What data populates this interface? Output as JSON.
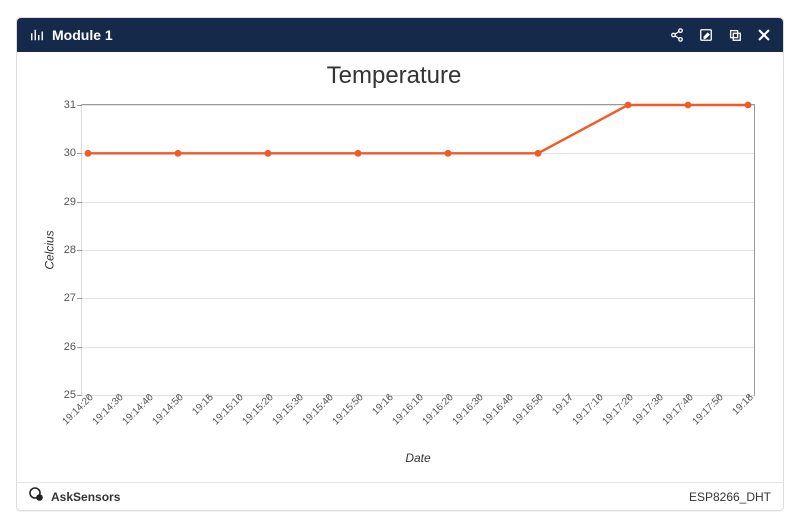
{
  "header": {
    "title": "Module 1",
    "iconName": "bar-chart-icon",
    "actions": {
      "share": "share-icon",
      "edit": "edit-icon",
      "copy": "copy-icon",
      "close": "close-icon"
    }
  },
  "footer": {
    "brand": "AskSensors",
    "device": "ESP8266_DHT"
  },
  "chart_data": {
    "type": "line",
    "title": "Temperature",
    "xlabel": "Date",
    "ylabel": "Celcius",
    "ylim": [
      25,
      31
    ],
    "yticks": [
      25,
      26,
      27,
      28,
      29,
      30,
      31
    ],
    "categories": [
      "19:14:20",
      "19:14:30",
      "19:14:40",
      "19:14:50",
      "19:15",
      "19:15:10",
      "19:15:20",
      "19:15:30",
      "19:15:40",
      "19:15:50",
      "19:16",
      "19:16:10",
      "19:16:20",
      "19:16:30",
      "19:16:40",
      "19:16:50",
      "19:17",
      "19:17:10",
      "19:17:20",
      "19:17:30",
      "19:17:40",
      "19:17:50",
      "19:18"
    ],
    "series": [
      {
        "name": "Temperature",
        "color": "#f15a24",
        "values": [
          30,
          null,
          null,
          null,
          null,
          30,
          null,
          null,
          null,
          null,
          30,
          null,
          null,
          null,
          null,
          30,
          null,
          null,
          null,
          null,
          null,
          null,
          null
        ]
      }
    ],
    "data_points": [
      {
        "x": "19:14:20",
        "y": 30
      },
      {
        "x": "19:14:50",
        "y": 30
      },
      {
        "x": "19:15:20",
        "y": 30
      },
      {
        "x": "19:15:50",
        "y": 30
      },
      {
        "x": "19:16:20",
        "y": 30
      },
      {
        "x": "19:16:50",
        "y": 30
      },
      {
        "x": "19:17:20",
        "y": 31
      },
      {
        "x": "19:17:40",
        "y": 31
      },
      {
        "x": "19:18",
        "y": 31
      }
    ]
  }
}
